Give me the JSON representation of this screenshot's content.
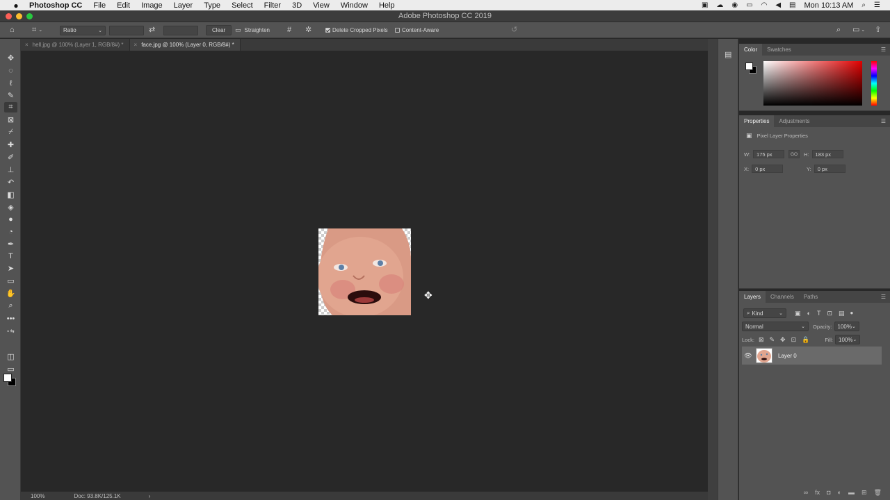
{
  "menubar": {
    "app_name": "Photoshop CC",
    "items": [
      "File",
      "Edit",
      "Image",
      "Layer",
      "Type",
      "Select",
      "Filter",
      "3D",
      "View",
      "Window",
      "Help"
    ],
    "clock": "Mon 10:13 AM"
  },
  "window": {
    "title": "Adobe Photoshop CC 2019"
  },
  "options_bar": {
    "ratio_label": "Ratio",
    "clear_label": "Clear",
    "straighten_label": "Straighten",
    "delete_cropped_label": "Delete Cropped Pixels",
    "delete_cropped_checked": true,
    "content_aware_label": "Content-Aware",
    "content_aware_checked": false
  },
  "tabs": [
    {
      "label": "hell.jpg @ 100% (Layer 1, RGB/8#) *",
      "active": false
    },
    {
      "label": "face.jpg @ 100% (Layer 0, RGB/8#) *",
      "active": true
    }
  ],
  "status": {
    "zoom": "100%",
    "doc": "Doc: 93.8K/125.1K",
    "arrow": "›"
  },
  "color_panel": {
    "tabs": [
      "Color",
      "Swatches"
    ],
    "active_tab": "Color",
    "accent_hex": "#e10000"
  },
  "properties_panel": {
    "tabs": [
      "Properties",
      "Adjustments"
    ],
    "active_tab": "Properties",
    "heading": "Pixel Layer Properties",
    "w_label": "W:",
    "w_value": "175 px",
    "link_label": "GO",
    "h_label": "H:",
    "h_value": "183 px",
    "x_label": "X:",
    "x_value": "0 px",
    "y_label": "Y:",
    "y_value": "0 px"
  },
  "layers_panel": {
    "tabs": [
      "Layers",
      "Channels",
      "Paths"
    ],
    "active_tab": "Layers",
    "filter_label": "Kind",
    "blend_mode": "Normal",
    "opacity_label": "Opacity:",
    "opacity_value": "100%",
    "lock_label": "Lock:",
    "fill_label": "Fill:",
    "fill_value": "100%",
    "layers": [
      {
        "name": "Layer 0",
        "visible": true
      }
    ]
  }
}
